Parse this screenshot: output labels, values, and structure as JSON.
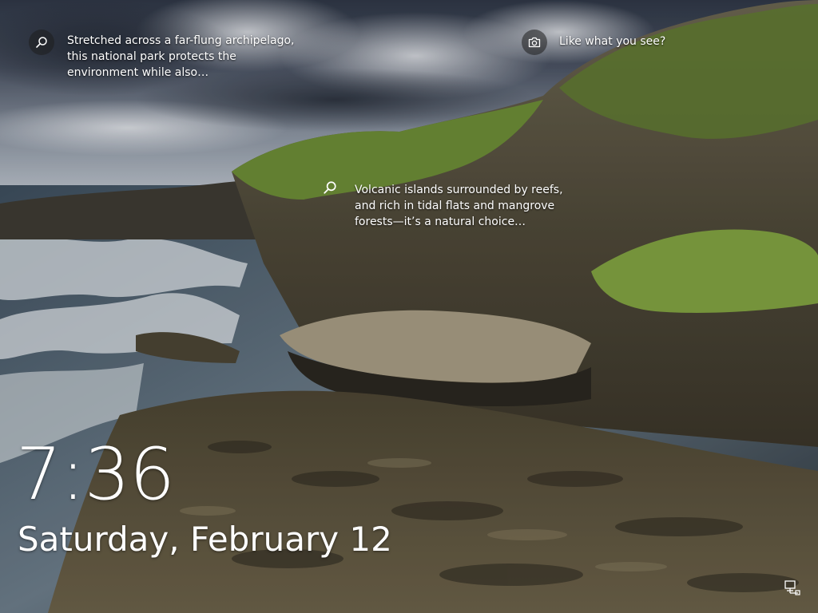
{
  "screen": "Windows lock screen",
  "spotlight": {
    "hotspots": [
      {
        "icon": "search-icon",
        "text": "Stretched across a far-flung archipelago, this national park protects the environment while also…"
      },
      {
        "icon": "camera-icon",
        "text": "Like what you see?"
      },
      {
        "icon": "search-icon",
        "text": "Volcanic islands surrounded by reefs, and rich in tidal flats and mangrove forests—it’s a natural choice…"
      }
    ]
  },
  "lock": {
    "time": "7:36",
    "date": "Saturday, February 12"
  },
  "tray": {
    "network_icon": "network-icon"
  },
  "colors": {
    "text": "#ffffff",
    "icon_circle": "#1e1e1e",
    "sky": "#4a5262",
    "sea": "#5a6a78",
    "grass": "#6b8a36",
    "rock": "#5e5643"
  }
}
